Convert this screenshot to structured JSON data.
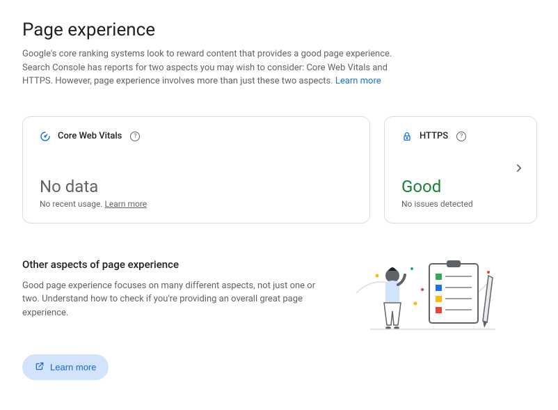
{
  "header": {
    "title": "Page experience",
    "intro": "Google's core ranking systems look to reward content that provides a good page experience. Search Console has reports for two aspects you may wish to consider: Core Web Vitals and HTTPS. However, page experience involves more than just these two aspects. ",
    "intro_link": "Learn more"
  },
  "cards": {
    "cwv": {
      "title": "Core Web Vitals",
      "status": "No data",
      "sub_prefix": "No recent usage. ",
      "sub_link": "Learn more"
    },
    "https": {
      "title": "HTTPS",
      "status": "Good",
      "sub": "No issues detected"
    }
  },
  "other": {
    "title": "Other aspects of page experience",
    "desc": "Good page experience focuses on many different aspects, not just one or two. Understand how to check if you're providing an overall great page experience.",
    "button": "Learn more"
  }
}
